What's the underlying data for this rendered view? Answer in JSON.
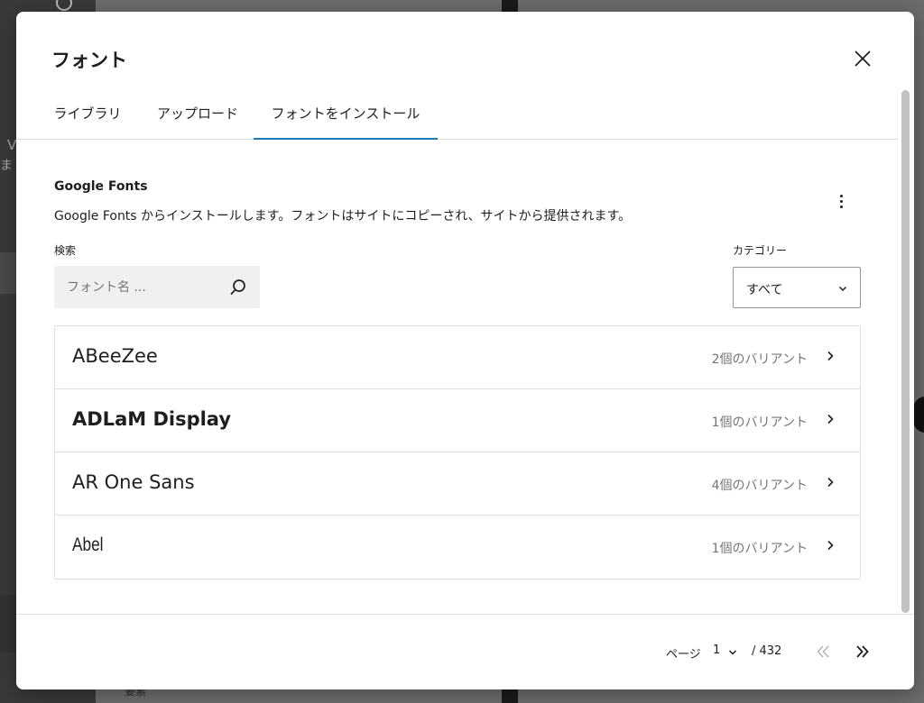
{
  "modal": {
    "title": "フォント",
    "close_label": "close"
  },
  "tabs": [
    {
      "label": "ライブラリ",
      "active": false
    },
    {
      "label": "アップロード",
      "active": false
    },
    {
      "label": "フォントをインストール",
      "active": true
    }
  ],
  "provider": {
    "title": "Google Fonts",
    "description": "Google Fonts からインストールします。フォントはサイトにコピーされ、サイトから提供されます。"
  },
  "search": {
    "label": "検索",
    "placeholder": "フォント名 ...",
    "value": ""
  },
  "category": {
    "label": "カテゴリー",
    "selected": "すべて"
  },
  "fonts": [
    {
      "name": "ABeeZee",
      "variants": "2個のバリアント"
    },
    {
      "name": "ADLaM Display",
      "variants": "1個のバリアント"
    },
    {
      "name": "AR One Sans",
      "variants": "4個のバリアント"
    },
    {
      "name": "Abel",
      "variants": "1個のバリアント"
    }
  ],
  "pagination": {
    "page_label": "ページ",
    "current_page": "1",
    "total": "/ 432"
  },
  "background": {
    "fragment_text": "要素"
  },
  "colors": {
    "accent": "#1f7bad",
    "text": "#1e1e1e",
    "muted": "#757575",
    "border": "#e0e0e0"
  }
}
